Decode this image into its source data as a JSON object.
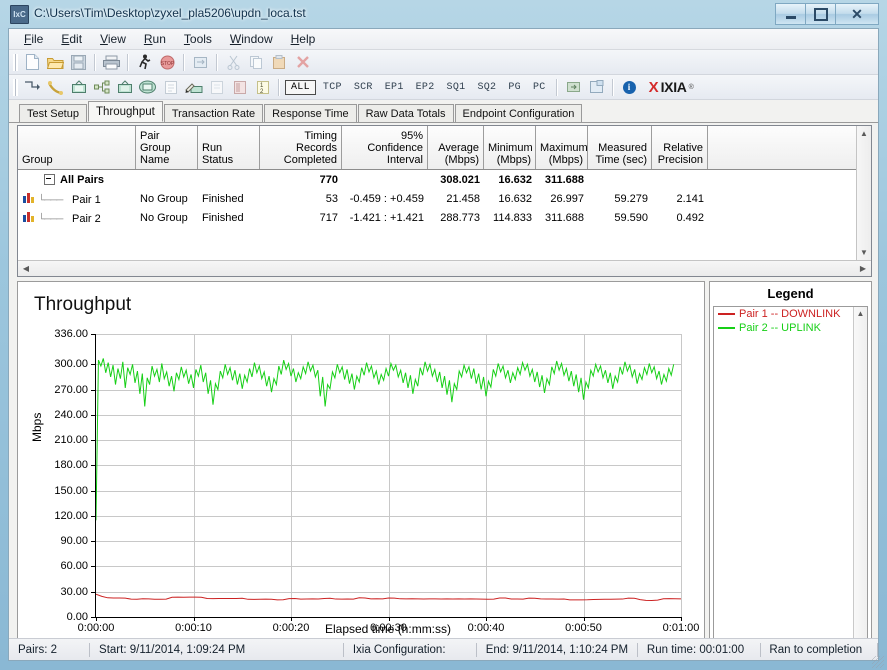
{
  "window": {
    "title": "C:\\Users\\Tim\\Desktop\\zyxel_pla5206\\updn_loca.tst",
    "app_icon": "ixchariot-icon",
    "minimize": "–",
    "maximize": "□",
    "close": "✕"
  },
  "menu": [
    {
      "label": "File"
    },
    {
      "label": "Edit"
    },
    {
      "label": "View"
    },
    {
      "label": "Run"
    },
    {
      "label": "Tools"
    },
    {
      "label": "Window"
    },
    {
      "label": "Help"
    }
  ],
  "toolbar_row1": [
    {
      "name": "new-icon"
    },
    {
      "name": "open-folder-icon"
    },
    {
      "name": "save-icon"
    },
    {
      "name": "print-icon"
    },
    {
      "name": "run-icon"
    },
    {
      "name": "stop-icon"
    },
    {
      "name": "refresh-icon"
    },
    {
      "name": "cut-icon"
    },
    {
      "name": "copy-icon"
    },
    {
      "name": "paste-icon"
    },
    {
      "name": "delete-icon"
    }
  ],
  "toolbar_row2": [
    {
      "name": "add-pair-icon"
    },
    {
      "name": "add-pair-phone-icon"
    },
    {
      "name": "add-multicast-pair-icon"
    },
    {
      "name": "add-pair-group-icon"
    },
    {
      "name": "add-vo-ip-pair-icon"
    },
    {
      "name": "add-video-pair-icon"
    },
    {
      "name": "edit-pair-icon"
    },
    {
      "name": "edit-script-icon"
    },
    {
      "name": "copy-pair-icon"
    },
    {
      "name": "hardware-pair-icon"
    },
    {
      "name": "sort-icon"
    }
  ],
  "protocol_filters": {
    "items": [
      "ALL",
      "TCP",
      "SCR",
      "EP1",
      "EP2",
      "SQ1",
      "SQ2",
      "PG",
      "PC"
    ],
    "selected": "ALL"
  },
  "toolbar_right": {
    "export_icon": "export-icon",
    "report_icon": "report-icon",
    "info_icon": "info-icon",
    "brand_x": "X",
    "brand_name": "IXIA",
    "brand_tm": "®"
  },
  "tabs": {
    "items": [
      {
        "label": "Test Setup",
        "active": false
      },
      {
        "label": "Throughput",
        "active": true
      },
      {
        "label": "Transaction Rate",
        "active": false
      },
      {
        "label": "Response Time",
        "active": false
      },
      {
        "label": "Raw Data Totals",
        "active": false
      },
      {
        "label": "Endpoint Configuration",
        "active": false
      }
    ]
  },
  "table": {
    "headers": [
      {
        "line1": "Group",
        "line2": "",
        "align": "left"
      },
      {
        "line1": "Pair Group",
        "line2": "Name",
        "align": "left"
      },
      {
        "line1": "Run Status",
        "line2": "",
        "align": "left"
      },
      {
        "line1": "Timing Records",
        "line2": "Completed",
        "align": "right"
      },
      {
        "line1": "95% Confidence",
        "line2": "Interval",
        "align": "right"
      },
      {
        "line1": "Average",
        "line2": "(Mbps)",
        "align": "right"
      },
      {
        "line1": "Minimum",
        "line2": "(Mbps)",
        "align": "right"
      },
      {
        "line1": "Maximum",
        "line2": "(Mbps)",
        "align": "right"
      },
      {
        "line1": "Measured",
        "line2": "Time (sec)",
        "align": "right"
      },
      {
        "line1": "Relative",
        "line2": "Precision",
        "align": "right"
      },
      {
        "line1": "",
        "line2": "",
        "align": "left"
      }
    ],
    "rows": [
      {
        "type": "group",
        "group": "All Pairs",
        "pair_group_name": "",
        "run_status": "",
        "timing_records": "770",
        "confidence_interval": "",
        "average": "308.021",
        "minimum": "16.632",
        "maximum": "311.688",
        "measured_time": "",
        "relative_precision": ""
      },
      {
        "type": "pair",
        "group": "Pair 1",
        "pair_group_name": "No Group",
        "run_status": "Finished",
        "timing_records": "53",
        "confidence_interval": "-0.459 : +0.459",
        "average": "21.458",
        "minimum": "16.632",
        "maximum": "26.997",
        "measured_time": "59.279",
        "relative_precision": "2.141"
      },
      {
        "type": "pair",
        "group": "Pair 2",
        "pair_group_name": "No Group",
        "run_status": "Finished",
        "timing_records": "717",
        "confidence_interval": "-1.421 : +1.421",
        "average": "288.773",
        "minimum": "114.833",
        "maximum": "311.688",
        "measured_time": "59.590",
        "relative_precision": "0.492"
      }
    ]
  },
  "chart_data": {
    "type": "line",
    "title": "Throughput",
    "xlabel": "Elapsed time (h:mm:ss)",
    "ylabel": "Mbps",
    "ylim": [
      0,
      336
    ],
    "yticks": [
      "0.00",
      "30.00",
      "60.00",
      "90.00",
      "120.00",
      "150.00",
      "180.00",
      "210.00",
      "240.00",
      "270.00",
      "300.00",
      "336.00"
    ],
    "ytick_values": [
      0,
      30,
      60,
      90,
      120,
      150,
      180,
      210,
      240,
      270,
      300,
      336
    ],
    "xticks": [
      "0:00:00",
      "0:00:10",
      "0:00:20",
      "0:00:30",
      "0:00:40",
      "0:00:50",
      "0:01:00"
    ],
    "xtick_values": [
      0,
      10,
      20,
      30,
      40,
      50,
      60
    ],
    "xlim": [
      0,
      60
    ],
    "grid": true,
    "legend_position": "right",
    "series": [
      {
        "name": "Pair 1 -- DOWNLINK",
        "color": "#cc2222",
        "x": [
          0,
          0.6,
          1.2,
          1.8,
          2.4,
          3,
          3.6,
          4.2,
          4.8,
          5.4,
          6,
          6.6,
          7.2,
          7.8,
          8.4,
          9,
          9.6,
          10.2,
          10.8,
          11.4,
          12,
          12.6,
          13.2,
          13.8,
          14.4,
          15,
          15.6,
          16.2,
          16.8,
          17.4,
          18,
          18.6,
          19.2,
          19.8,
          20.4,
          21,
          21.6,
          22.2,
          22.8,
          23.4,
          24,
          24.6,
          25.2,
          25.8,
          26.4,
          27,
          27.6,
          28.2,
          28.8,
          29.4,
          30,
          30.6,
          31.2,
          31.8,
          32.4,
          33,
          33.6,
          34.2,
          34.8,
          35.4,
          36,
          36.6,
          37.2,
          37.8,
          38.4,
          39,
          39.6,
          40.2,
          40.8,
          41.4,
          42,
          42.6,
          43.2,
          43.8,
          44.4,
          45,
          45.6,
          46.2,
          46.8,
          47.4,
          48,
          48.6,
          49.2,
          49.8,
          50.4,
          51,
          51.6,
          52.2,
          52.8,
          53.4,
          54,
          54.6,
          55.2,
          55.8,
          56.4,
          57,
          57.6,
          58.2,
          58.8,
          59.4,
          60
        ],
        "y": [
          27.0,
          24.5,
          22.8,
          22.6,
          22.5,
          22.4,
          21.2,
          21.0,
          21.6,
          21.5,
          21.0,
          21.0,
          21.2,
          23.4,
          23.6,
          23.5,
          23.6,
          23.6,
          23.5,
          22.0,
          21.8,
          21.9,
          22.0,
          22.0,
          21.9,
          22.2,
          21.0,
          20.9,
          21.0,
          21.2,
          21.0,
          20.4,
          20.5,
          21.8,
          21.9,
          21.2,
          21.4,
          21.5,
          21.4,
          22.0,
          22.2,
          21.3,
          21.2,
          21.3,
          21.2,
          22.8,
          22.6,
          21.5,
          21.6,
          21.5,
          22.5,
          22.4,
          21.6,
          21.5,
          21.6,
          21.5,
          21.4,
          21.5,
          21.5,
          21.4,
          21.5,
          21.4,
          21.5,
          21.4,
          21.5,
          21.4,
          21.2,
          21.0,
          21.2,
          22.6,
          22.5,
          21.4,
          21.3,
          21.2,
          22.4,
          22.3,
          21.5,
          21.4,
          21.3,
          21.2,
          21.3,
          20.4,
          20.3,
          20.4,
          20.5,
          20.8,
          20.9,
          21.0,
          21.0,
          21.2,
          21.3,
          22.4,
          22.3,
          20.6,
          19.8,
          19.6,
          20.0,
          21.6,
          21.8,
          21.6,
          21.5
        ]
      },
      {
        "name": "Pair 2 -- UPLINK",
        "color": "#17cf17",
        "x": [
          0,
          0.25,
          0.5,
          0.75,
          1,
          1.25,
          1.5,
          1.75,
          2,
          2.25,
          2.5,
          2.75,
          3,
          3.25,
          3.5,
          3.75,
          4,
          4.25,
          4.5,
          4.75,
          5,
          5.25,
          5.5,
          5.75,
          6,
          6.25,
          6.5,
          6.75,
          7,
          7.25,
          7.5,
          7.75,
          8,
          8.25,
          8.5,
          8.75,
          9,
          9.25,
          9.5,
          9.75,
          10,
          10.25,
          10.5,
          10.75,
          11,
          11.25,
          11.5,
          11.75,
          12,
          12.25,
          12.5,
          12.75,
          13,
          13.25,
          13.5,
          13.75,
          14,
          14.25,
          14.5,
          14.75,
          15,
          15.25,
          15.5,
          15.75,
          16,
          16.25,
          16.5,
          16.75,
          17,
          17.25,
          17.5,
          17.75,
          18,
          18.25,
          18.5,
          18.75,
          19,
          19.25,
          19.5,
          19.75,
          20,
          20.25,
          20.5,
          20.75,
          21,
          21.25,
          21.5,
          21.75,
          22,
          22.25,
          22.5,
          22.75,
          23,
          23.25,
          23.5,
          23.75,
          24,
          24.25,
          24.5,
          24.75,
          25,
          25.25,
          25.5,
          25.75,
          26,
          26.25,
          26.5,
          26.75,
          27,
          27.25,
          27.5,
          27.75,
          28,
          28.25,
          28.5,
          28.75,
          29,
          29.25,
          29.5,
          29.75,
          30,
          30.25,
          30.5,
          30.75,
          31,
          31.25,
          31.5,
          31.75,
          32,
          32.25,
          32.5,
          32.75,
          33,
          33.25,
          33.5,
          33.75,
          34,
          34.25,
          34.5,
          34.75,
          35,
          35.25,
          35.5,
          35.75,
          36,
          36.25,
          36.5,
          36.75,
          37,
          37.25,
          37.5,
          37.75,
          38,
          38.25,
          38.5,
          38.75,
          39,
          39.25,
          39.5,
          39.75,
          40,
          40.25,
          40.5,
          40.75,
          41,
          41.25,
          41.5,
          41.75,
          42,
          42.25,
          42.5,
          42.75,
          43,
          43.25,
          43.5,
          43.75,
          44,
          44.25,
          44.5,
          44.75,
          45,
          45.25,
          45.5,
          45.75,
          46,
          46.25,
          46.5,
          46.75,
          47,
          47.25,
          47.5,
          47.75,
          48,
          48.25,
          48.5,
          48.75,
          49,
          49.25,
          49.5,
          49.75,
          50,
          50.25,
          50.5,
          50.75,
          51,
          51.25,
          51.5,
          51.75,
          52,
          52.25,
          52.5,
          52.75,
          53,
          53.25,
          53.5,
          53.75,
          54,
          54.25,
          54.5,
          54.75,
          55,
          55.25,
          55.5,
          55.75,
          56,
          56.25,
          56.5,
          56.75,
          57,
          57.25,
          57.5,
          57.75,
          58,
          58.25,
          58.5,
          58.75,
          59,
          59.25,
          59.5,
          59.75,
          60
        ],
        "y": [
          114.8,
          305,
          298,
          307,
          290,
          302,
          285,
          299,
          276,
          295,
          283,
          303,
          272,
          296,
          288,
          300,
          278,
          292,
          265,
          289,
          250,
          284,
          276,
          298,
          286,
          294,
          279,
          301,
          283,
          291,
          274,
          286,
          268,
          290,
          282,
          297,
          285,
          293,
          277,
          288,
          272,
          294,
          286,
          299,
          279,
          290,
          265,
          281,
          252,
          277,
          270,
          292,
          284,
          300,
          288,
          296,
          281,
          293,
          276,
          289,
          271,
          287,
          279,
          295,
          285,
          302,
          290,
          298,
          283,
          291,
          274,
          286,
          267,
          283,
          276,
          298,
          288,
          305,
          294,
          301,
          286,
          295,
          279,
          290,
          283,
          297,
          289,
          303,
          292,
          299,
          285,
          293,
          262,
          285,
          250,
          276,
          271,
          291,
          284,
          300,
          290,
          297,
          282,
          294,
          277,
          289,
          270,
          286,
          279,
          296,
          287,
          302,
          291,
          298,
          284,
          292,
          276,
          288,
          281,
          295,
          286,
          301,
          293,
          299,
          285,
          293,
          278,
          290,
          272,
          287,
          265,
          282,
          274,
          296,
          287,
          303,
          292,
          300,
          286,
          294,
          279,
          291,
          272,
          286,
          264,
          281,
          255,
          277,
          270,
          292,
          285,
          299,
          290,
          297,
          283,
          295,
          277,
          289,
          270,
          285,
          262,
          280,
          273,
          294,
          286,
          301,
          291,
          298,
          284,
          293,
          278,
          290,
          282,
          296,
          288,
          302,
          293,
          300,
          286,
          294,
          279,
          291,
          273,
          287,
          266,
          283,
          276,
          297,
          289,
          304,
          293,
          301,
          287,
          295,
          280,
          292,
          274,
          288,
          267,
          284,
          258,
          279,
          272,
          293,
          286,
          300,
          291,
          298,
          284,
          293,
          278,
          290,
          271,
          286,
          279,
          297,
          288,
          303,
          292,
          299,
          285,
          294,
          277,
          289,
          282,
          296,
          288,
          301,
          290,
          297,
          283,
          292,
          276,
          288,
          280,
          295,
          287,
          300
        ]
      }
    ]
  },
  "legend": {
    "title": "Legend",
    "items": [
      {
        "label": "Pair 1 -- DOWNLINK",
        "color": "#cc2222"
      },
      {
        "label": "Pair 2 -- UPLINK",
        "color": "#17cf17"
      }
    ]
  },
  "statusbar": {
    "pairs": "Pairs: 2",
    "start": "Start: 9/11/2014, 1:09:24 PM",
    "configuration": "Ixia Configuration:",
    "end": "End: 9/11/2014, 1:10:24 PM",
    "runtime": "Run time: 00:01:00",
    "result": "Ran to completion"
  }
}
